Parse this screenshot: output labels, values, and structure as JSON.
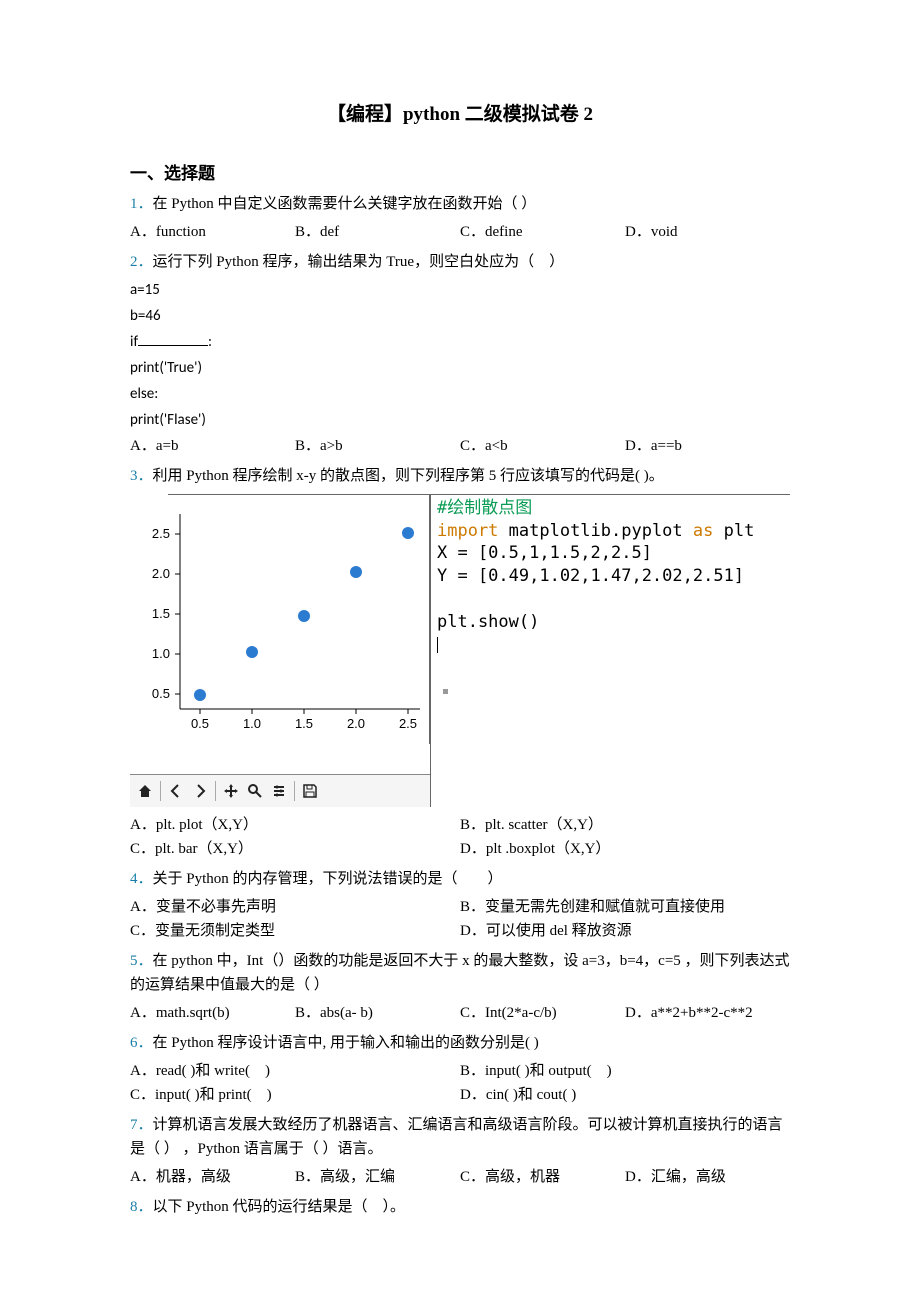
{
  "title": "【编程】python 二级模拟试卷 2",
  "section1": "一、选择题",
  "q1": {
    "num": "1．",
    "text": "在 Python 中自定义函数需要什么关键字放在函数开始（ ）",
    "a": "A．function",
    "b": "B．def",
    "c": "C．define",
    "d": "D．void"
  },
  "q2": {
    "num": "2．",
    "text": "运行下列 Python 程序，输出结果为 True，则空白处应为（　）",
    "code1": "a=15",
    "code2": "b=46",
    "code3_pre": "if",
    "code3_post": ":",
    "code4": "print('True')",
    "code5": "else:",
    "code6": "print('Flase')",
    "a": "A．a=b",
    "b": "B．a>b",
    "c": "C．a<b",
    "d": "D．a==b"
  },
  "q3": {
    "num": "3．",
    "text": "利用 Python 程序绘制 x-y 的散点图，则下列程序第 5 行应该填写的代码是( )。",
    "a": "A．plt. plot（X,Y）",
    "b": "B．plt. scatter（X,Y）",
    "c": "C．plt. bar（X,Y）",
    "d": "D．plt .boxplot（X,Y）",
    "code_comment": "#绘制散点图",
    "code_l2_a": "import",
    "code_l2_b": " matplotlib.pyplot ",
    "code_l2_c": "as",
    "code_l2_d": " plt",
    "code_l3": "X = [0.5,1,1.5,2,2.5]",
    "code_l4": "Y = [0.49,1.02,1.47,2.02,2.51]",
    "code_l5": "plt.show()"
  },
  "q4": {
    "num": "4．",
    "text": "关于 Python 的内存管理，下列说法错误的是（　　）",
    "a": "A．变量不必事先声明",
    "b": "B．变量无需先创建和赋值就可直接使用",
    "c": "C．变量无须制定类型",
    "d": "D．可以使用 del 释放资源"
  },
  "q5": {
    "num": "5．",
    "text": "在 python 中，Int（）函数的功能是返回不大于 x 的最大整数，设 a=3，b=4，c=5 ，则下列表达式的运算结果中值最大的是（ ）",
    "a": "A．math.sqrt(b)",
    "b": "B．abs(a- b)",
    "c": "C．Int(2*a-c/b)",
    "d": "D．a**2+b**2-c**2"
  },
  "q6": {
    "num": "6．",
    "text": "在 Python 程序设计语言中, 用于输入和输出的函数分别是(  )",
    "a": "A．read(  )和 write(　)",
    "b": "B．input(  )和 output(　)",
    "c": "C．input(  )和 print(　)",
    "d": "D．cin(  )和 cout(  )"
  },
  "q7": {
    "num": "7．",
    "text": "计算机语言发展大致经历了机器语言、汇编语言和高级语言阶段。可以被计算机直接执行的语言是（ ） ，Python 语言属于（ ）语言。",
    "a": "A．机器，高级",
    "b": "B．高级，汇编",
    "c": "C．高级，机器",
    "d": "D．汇编，高级"
  },
  "q8": {
    "num": "8．",
    "text": "以下 Python 代码的运行结果是（　）。"
  },
  "chart_data": {
    "type": "scatter",
    "x": [
      0.5,
      1.0,
      1.5,
      2.0,
      2.5
    ],
    "y": [
      0.49,
      1.02,
      1.47,
      2.02,
      2.51
    ],
    "x_ticks": [
      "0.5",
      "1.0",
      "1.5",
      "2.0",
      "2.5"
    ],
    "y_ticks": [
      "0.5",
      "1.0",
      "1.5",
      "2.0",
      "2.5"
    ],
    "xlim": [
      0.3,
      2.7
    ],
    "ylim": [
      0.3,
      2.7
    ]
  }
}
